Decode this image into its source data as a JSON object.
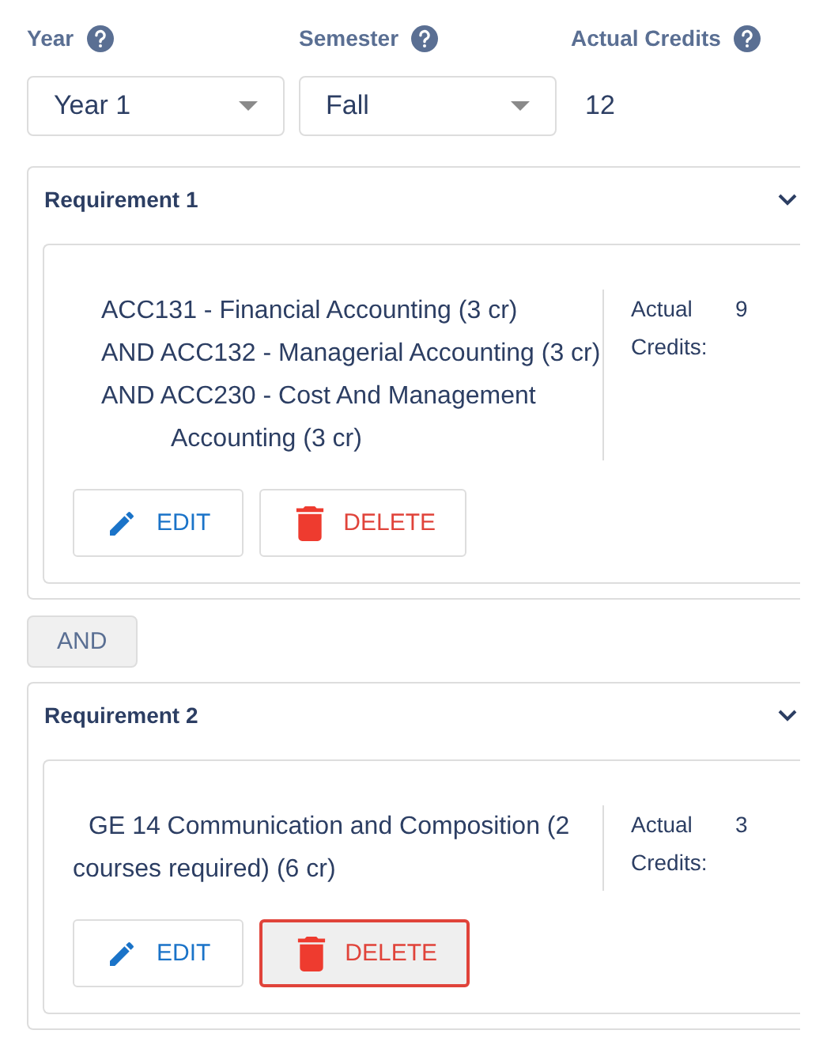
{
  "filters": [
    {
      "label": "Year",
      "kind": "select",
      "value": "Year 1"
    },
    {
      "label": "Semester",
      "kind": "select",
      "value": "Fall"
    },
    {
      "label": "Actual Credits",
      "kind": "text",
      "value": "12"
    }
  ],
  "requirements": [
    {
      "title": "Requirement 1",
      "expanded": true,
      "lines": [
        {
          "kind": "first",
          "text": "ACC131 - Financial Accounting (3 cr)"
        },
        {
          "kind": "and",
          "text": "AND ACC132 - Managerial Accounting (3 cr)"
        },
        {
          "kind": "and",
          "text": "AND ACC230 - Cost And Management Accounting (3 cr)"
        }
      ],
      "credits_label": "Actual Credits:",
      "credits": "9",
      "edit": {
        "label": "EDIT",
        "focused": false
      },
      "delete": {
        "label": "DELETE",
        "focused": false
      }
    },
    {
      "title": "Requirement 2",
      "expanded": true,
      "lines": [
        {
          "kind": "group",
          "text": "GE 14 Communication and Composition (2 courses required) (6 cr)"
        }
      ],
      "credits_label": "Actual Credits:",
      "credits": "3",
      "edit": {
        "label": "EDIT",
        "focused": false
      },
      "delete": {
        "label": "DELETE",
        "focused": true
      }
    }
  ],
  "connector": "AND"
}
